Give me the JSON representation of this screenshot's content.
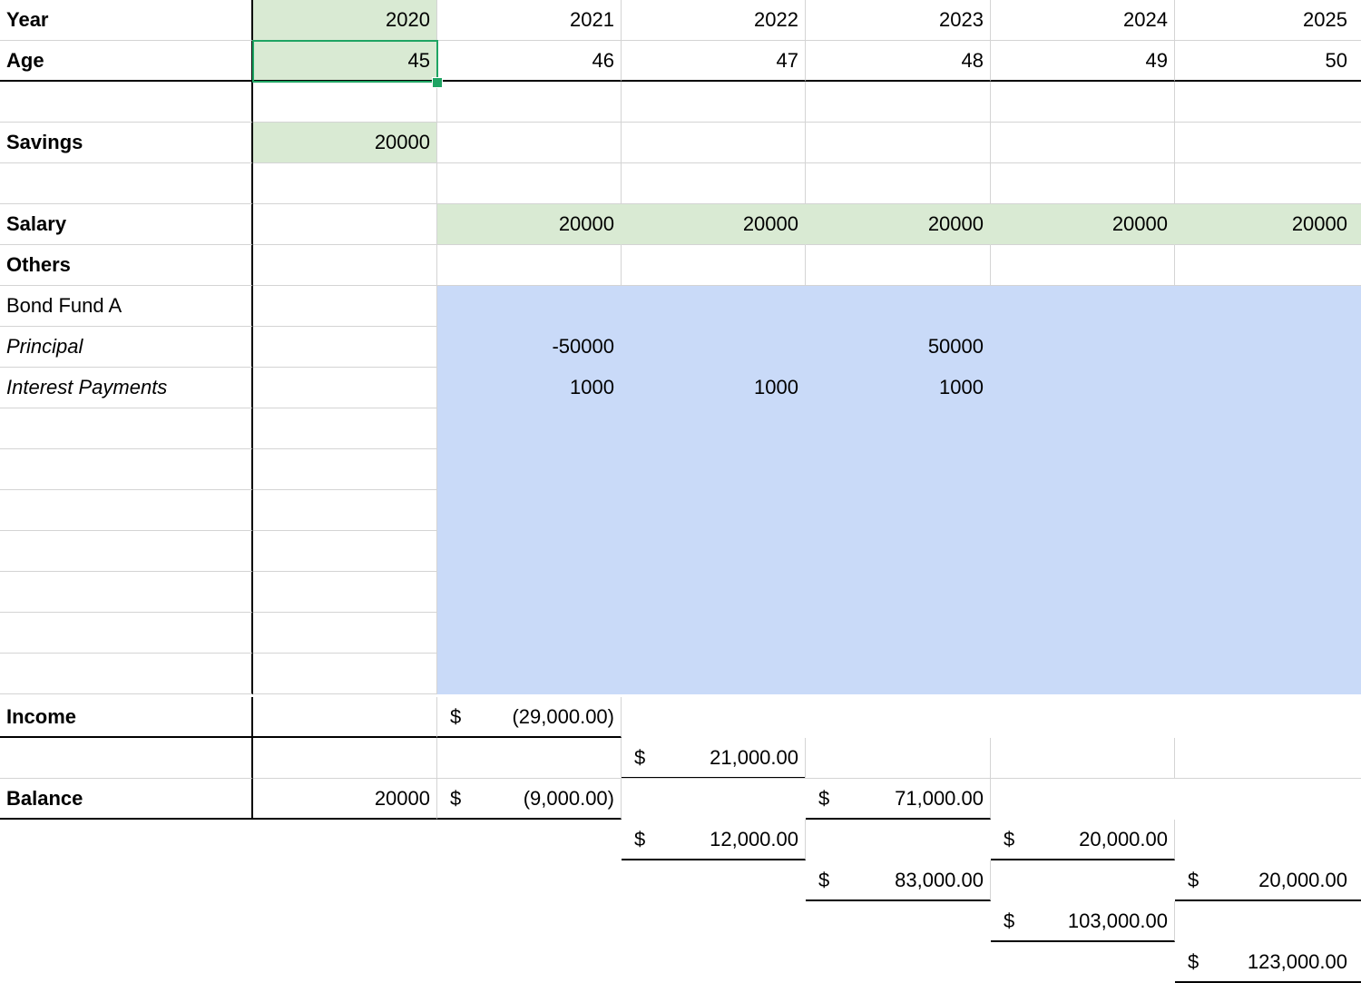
{
  "sheet": {
    "year": {
      "label": "Year",
      "values": [
        "2020",
        "2021",
        "2022",
        "2023",
        "2024",
        "2025"
      ]
    },
    "age": {
      "label": "Age",
      "values": [
        "45",
        "46",
        "47",
        "48",
        "49",
        "50"
      ]
    },
    "savings": {
      "label": "Savings",
      "value": "20000"
    },
    "salary": {
      "label": "Salary",
      "values": [
        "20000",
        "20000",
        "20000",
        "20000",
        "20000"
      ]
    },
    "others": {
      "label": "Others"
    },
    "bond_fund": {
      "label": "Bond Fund A"
    },
    "principal": {
      "label": "Principal",
      "values": [
        "-50000",
        "",
        "50000",
        "",
        ""
      ]
    },
    "interest": {
      "label": "Interest Payments",
      "values": [
        "1000",
        "1000",
        "1000",
        "",
        ""
      ]
    },
    "income": {
      "label": "Income",
      "currency": "$",
      "values": [
        "(29,000.00)",
        "21,000.00",
        "71,000.00",
        "20,000.00",
        "20,000.00"
      ]
    },
    "balance": {
      "label": "Balance",
      "start": "20000",
      "currency": "$",
      "values": [
        "(9,000.00)",
        "12,000.00",
        "83,000.00",
        "103,000.00",
        "123,000.00"
      ]
    }
  },
  "selection": {
    "cell": "B2"
  },
  "colors": {
    "input_green": "#d9ead3",
    "bond_blue": "#c9daf8",
    "selection": "#1fa463"
  }
}
